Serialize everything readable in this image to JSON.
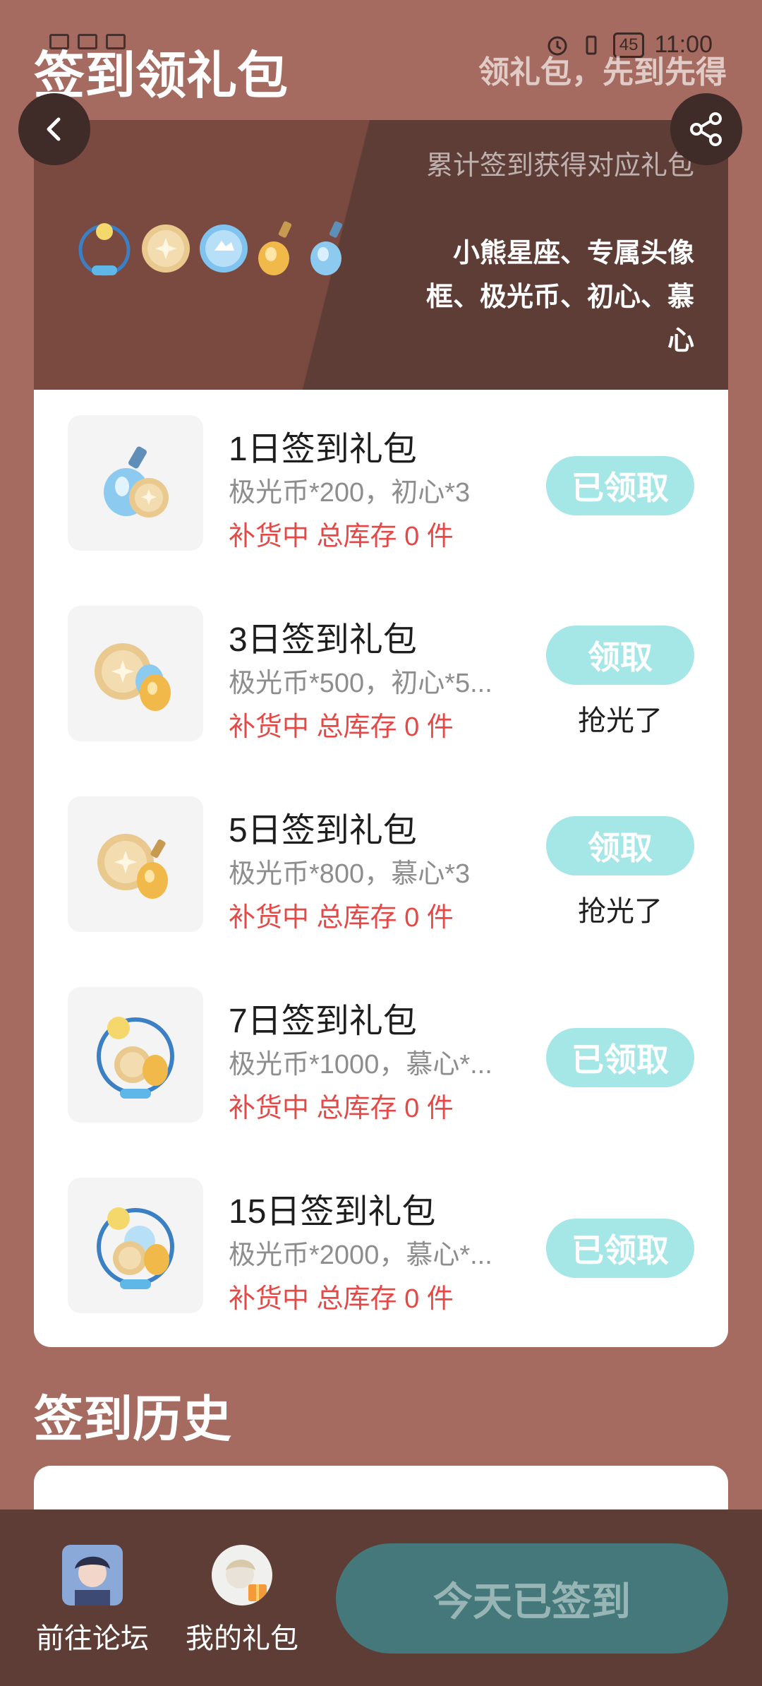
{
  "status_bar": {
    "time": "11:00",
    "battery": "45"
  },
  "header": {
    "title": "签到领礼包",
    "subtitle": "领礼包，先到先得"
  },
  "banner": {
    "description": "累计签到获得对应礼包",
    "items": "小熊星座、专属头像框、极光币、初心、慕心"
  },
  "gifts": [
    {
      "name": "1日签到礼包",
      "content": "极光币*200，初心*3",
      "stock": "补货中 总库存 0 件",
      "button": "已领取",
      "sold_out": ""
    },
    {
      "name": "3日签到礼包",
      "content": "极光币*500，初心*5...",
      "stock": "补货中 总库存 0 件",
      "button": "领取",
      "sold_out": "抢光了"
    },
    {
      "name": "5日签到礼包",
      "content": "极光币*800，慕心*3",
      "stock": "补货中 总库存 0 件",
      "button": "领取",
      "sold_out": "抢光了"
    },
    {
      "name": "7日签到礼包",
      "content": "极光币*1000，慕心*...",
      "stock": "补货中 总库存 0 件",
      "button": "已领取",
      "sold_out": ""
    },
    {
      "name": "15日签到礼包",
      "content": "极光币*2000，慕心*...",
      "stock": "补货中 总库存 0 件",
      "button": "已领取",
      "sold_out": ""
    }
  ],
  "history": {
    "title": "签到历史"
  },
  "bottom_bar": {
    "forum_label": "前往论坛",
    "my_gifts_label": "我的礼包",
    "signed_button": "今天已签到"
  },
  "colors": {
    "background": "#a56b60",
    "banner_dark": "#5e3d37",
    "claim_button": "#a5e6e7",
    "stock_red": "#e34a47",
    "signed_button": "#44787a"
  }
}
